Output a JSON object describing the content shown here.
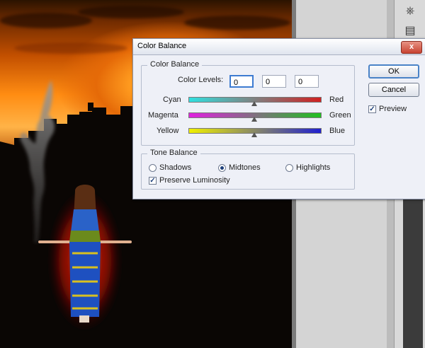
{
  "dialog": {
    "title": "Color Balance",
    "close_label": "x",
    "color_balance": {
      "legend": "Color Balance",
      "levels_label": "Color Levels:",
      "levels": [
        "0",
        "0",
        "0"
      ],
      "sliders": [
        {
          "left": "Cyan",
          "right": "Red",
          "value": 0
        },
        {
          "left": "Magenta",
          "right": "Green",
          "value": 0
        },
        {
          "left": "Yellow",
          "right": "Blue",
          "value": 0
        }
      ]
    },
    "tone_balance": {
      "legend": "Tone Balance",
      "options": [
        "Shadows",
        "Midtones",
        "Highlights"
      ],
      "selected": "Midtones",
      "preserve_label": "Preserve Luminosity",
      "preserve_checked": true
    },
    "buttons": {
      "ok": "OK",
      "cancel": "Cancel"
    },
    "preview": {
      "label": "Preview",
      "checked": true
    },
    "check_glyph": "✓"
  },
  "colors": {
    "cyan_red": [
      "#30e0e0",
      "#d02020"
    ],
    "magenta_green": [
      "#e020e0",
      "#20c020"
    ],
    "yellow_blue": [
      "#f0f000",
      "#2020d0"
    ]
  },
  "tools": {
    "icons": [
      "usb-plug-icon",
      "clipboard-icon"
    ]
  }
}
